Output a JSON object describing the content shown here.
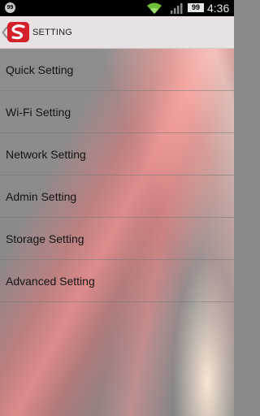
{
  "status_bar": {
    "notification_badge": "99",
    "battery_level": "99",
    "time": "4:36",
    "icons": [
      "notification-icon",
      "wifi-icon",
      "signal-icon",
      "battery-icon"
    ]
  },
  "action_bar": {
    "title": "SETTING",
    "logo_icon": "s-logo-icon",
    "back_icon": "chevron-left-icon"
  },
  "menu": {
    "items": [
      {
        "label": "Quick Setting"
      },
      {
        "label": "Wi-Fi Setting"
      },
      {
        "label": "Network Setting"
      },
      {
        "label": "Admin Setting"
      },
      {
        "label": "Storage Setting"
      },
      {
        "label": "Advanced Setting"
      }
    ]
  },
  "colors": {
    "action_bar_bg": "#e8e2e3",
    "logo_red": "#d4202a",
    "status_bar_bg": "#000000"
  }
}
